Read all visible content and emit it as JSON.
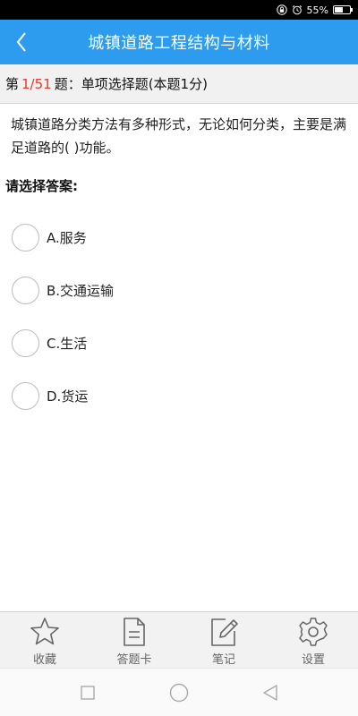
{
  "status_bar": {
    "battery_text": "55%",
    "battery_level": 0.55,
    "icons": [
      "lock-icon",
      "alarm-icon",
      "battery-icon"
    ]
  },
  "header": {
    "title": "城镇道路工程结构与材料",
    "back_icon": "chevron-left-icon",
    "background_color": "#2d9cee"
  },
  "question": {
    "prefix": "第",
    "number": "1/51",
    "suffix": "题：单项选择题(本题1分)",
    "number_color": "#e23a2a",
    "text": "城镇道路分类方法有多种形式，无论如何分类，主要是满足道路的( )功能。",
    "prompt": "请选择答案:"
  },
  "options": [
    {
      "label": "A.服务"
    },
    {
      "label": "B.交通运输"
    },
    {
      "label": "C.生活"
    },
    {
      "label": "D.货运"
    }
  ],
  "bottom_nav": [
    {
      "label": "收藏",
      "icon": "star-icon"
    },
    {
      "label": "答题卡",
      "icon": "document-icon"
    },
    {
      "label": "笔记",
      "icon": "edit-note-icon"
    },
    {
      "label": "设置",
      "icon": "gear-icon"
    }
  ],
  "system_nav": {
    "icons": [
      "recent-apps-icon",
      "home-icon",
      "back-triangle-icon"
    ]
  }
}
